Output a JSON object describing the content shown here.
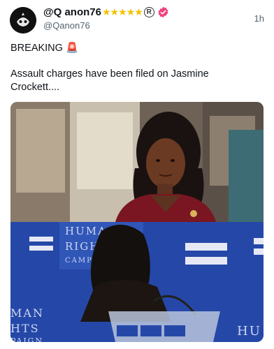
{
  "post": {
    "author": {
      "display_name": "@Q anon76",
      "stars": "★★★★★",
      "registered_mark": "R",
      "handle": "@Qanon76",
      "avatar_icon": "skull-avatar-icon",
      "verified_icon": "verified-badge-icon",
      "verified_color": "#f0417d"
    },
    "time": "1h",
    "text_line1": "BREAKING 🚨",
    "text_line2": "Assault charges have been filed on Jasmine Crockett....",
    "media": {
      "top_description_icon": "woman-portrait-photo",
      "bottom_banner": {
        "left_letters": [
          "HUMA",
          "RIGH",
          "CAMP"
        ],
        "lower_left": [
          "MAN",
          "HTS",
          "PAIGN"
        ],
        "right_letters": "HU"
      }
    }
  }
}
